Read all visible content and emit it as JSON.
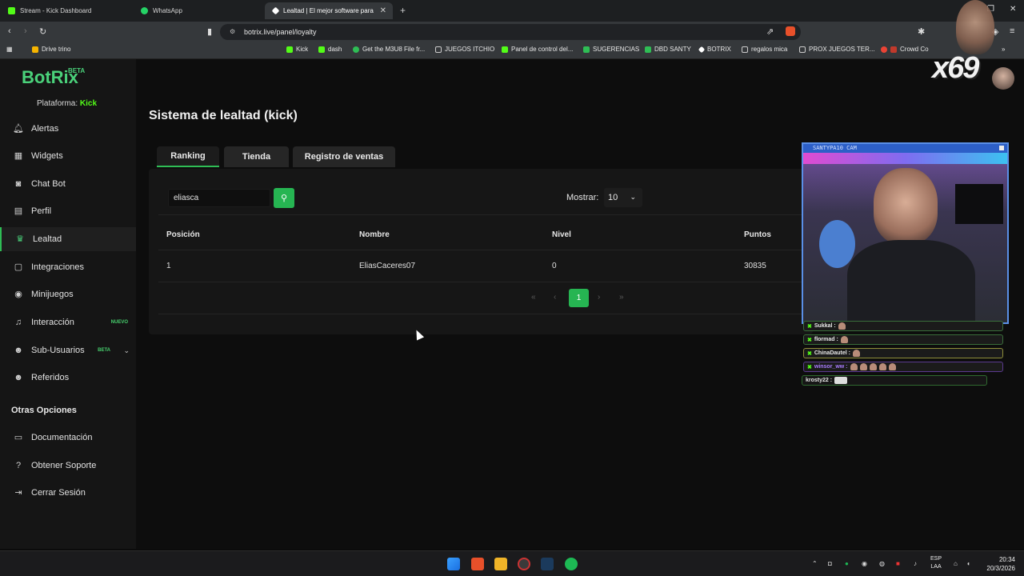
{
  "browser": {
    "tabs": [
      {
        "label": "Stream - Kick Dashboard",
        "color": "#53fc18"
      },
      {
        "label": "WhatsApp",
        "color": "#25d366"
      },
      {
        "label": "Lealtad | El mejor software para",
        "color": "#ffffff"
      }
    ],
    "url": "botrix.live/panel/loyalty",
    "bookmarks": [
      "Drive trino",
      "Kick",
      "dash",
      "Get the M3U8 File fr...",
      "JUEGOS ITCHIO",
      "Panel de control del...",
      "SUGERENCIAS",
      "DBD SANTY",
      "BOTRIX",
      "regalos mica",
      "PROX JUEGOS TER...",
      "Crowd Co"
    ]
  },
  "brand": {
    "name": "BotRix",
    "tag": "BETA"
  },
  "platform": {
    "label": "Plataforma:",
    "value": "Kick"
  },
  "sidebar": {
    "items": [
      {
        "label": "Alertas",
        "icon": "bell-icon"
      },
      {
        "label": "Widgets",
        "icon": "grid-icon"
      },
      {
        "label": "Chat Bot",
        "icon": "robot-icon"
      },
      {
        "label": "Perfil",
        "icon": "id-card-icon"
      },
      {
        "label": "Lealtad",
        "icon": "trophy-icon"
      },
      {
        "label": "Integraciones",
        "icon": "plug-icon"
      },
      {
        "label": "Minijuegos",
        "icon": "gamepad-icon"
      },
      {
        "label": "Interacción",
        "icon": "music-icon",
        "badge": "NUEVO"
      },
      {
        "label": "Sub-Usuarios",
        "icon": "users-icon",
        "badge": "BETA"
      },
      {
        "label": "Referidos",
        "icon": "people-icon"
      }
    ],
    "other_title": "Otras Opciones",
    "other_items": [
      {
        "label": "Documentación",
        "icon": "document-icon"
      },
      {
        "label": "Obtener Soporte",
        "icon": "help-icon"
      },
      {
        "label": "Cerrar Sesión",
        "icon": "logout-icon"
      }
    ]
  },
  "main": {
    "title": "Sistema de lealtad (kick)",
    "tabs": [
      "Ranking",
      "Tienda",
      "Registro de ventas"
    ],
    "search_value": "eliasca",
    "show_label": "Mostrar:",
    "show_value": "10",
    "columns": [
      "Posición",
      "Nombre",
      "Nivel",
      "Puntos"
    ],
    "rows": [
      [
        "1",
        "EliasCaceres07",
        "0",
        "30835"
      ]
    ],
    "pagination": {
      "first": "«",
      "prev": "‹",
      "current": "1",
      "next": "›",
      "last": "»"
    }
  },
  "overlay": {
    "cam_title": "SANTYPA10 CAM",
    "chat": [
      {
        "user": "Sukkal :"
      },
      {
        "user": "flormad :"
      },
      {
        "user": "ChinaDautel :"
      },
      {
        "user": "winsor_ww :"
      },
      {
        "user": "krosty22 :"
      }
    ],
    "counter": "x69"
  },
  "taskbar": {
    "lang_1": "ESP",
    "lang_2": "LAA",
    "time": "20:34",
    "date": "20/3/2026"
  },
  "colors": {
    "accent": "#26b552",
    "kick_green": "#53fc18"
  }
}
